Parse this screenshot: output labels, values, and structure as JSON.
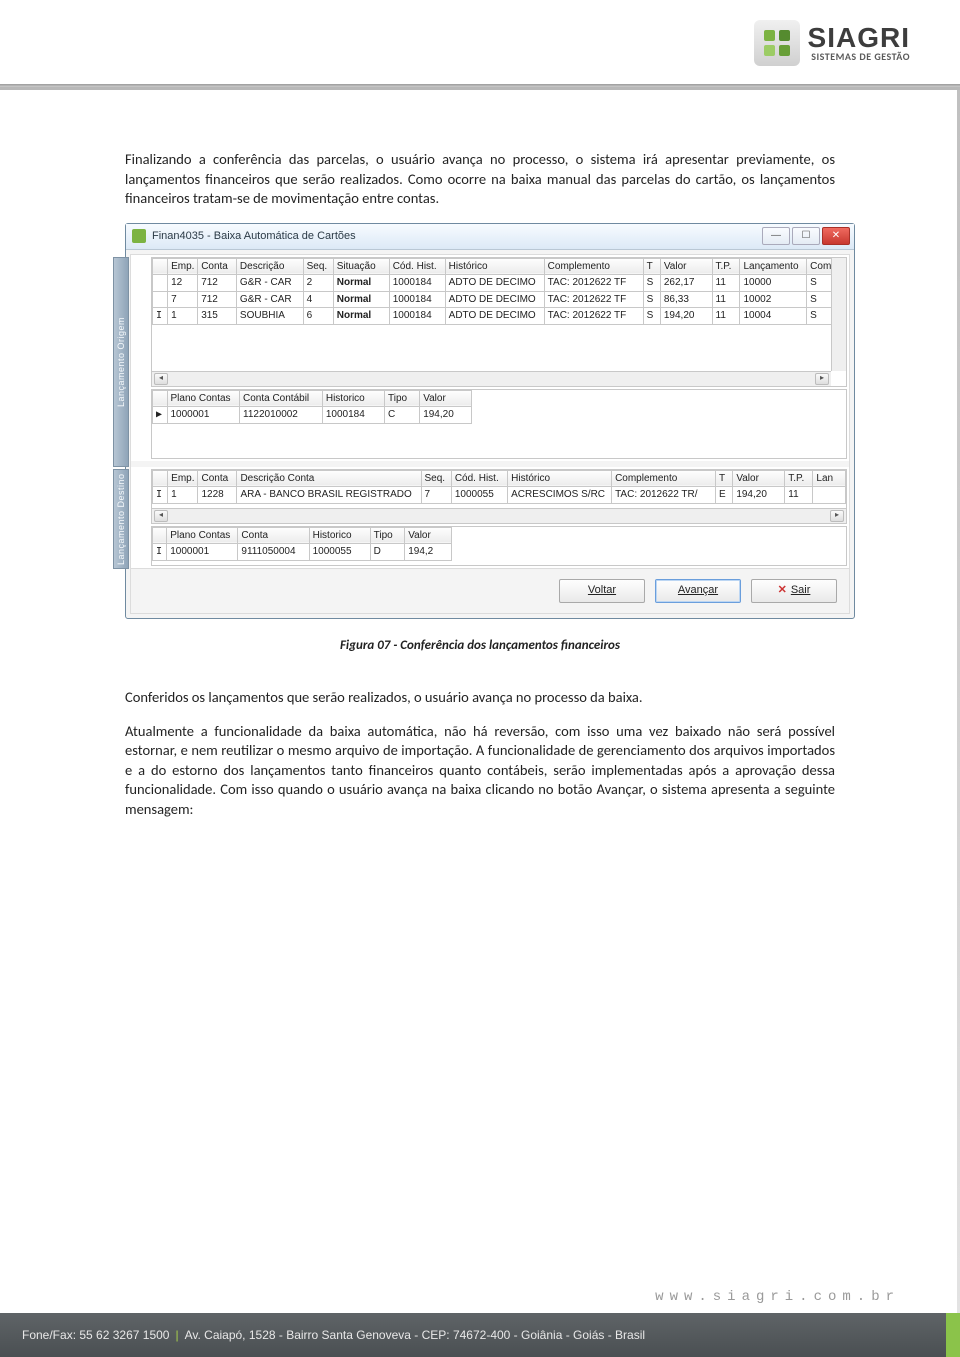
{
  "brand": {
    "name": "SIAGRI",
    "tagline": "SISTEMAS DE GESTÃO"
  },
  "para1": "Finalizando a conferência das parcelas, o usuário avança no processo, o sistema irá apresentar previamente, os lançamentos financeiros que serão realizados. Como ocorre na baixa manual das parcelas do cartão, os lançamentos financeiros tratam-se de movimentação entre contas.",
  "window": {
    "title": "Finan4035 - Baixa Automática de Cartões",
    "origem_label": "Lançamento Origem",
    "destino_label": "Lançamento Destino",
    "grid1": {
      "headers": [
        "",
        "Emp.",
        "Conta",
        "Descrição",
        "Seq.",
        "Situação",
        "Cód. Hist.",
        "Histórico",
        "Complemento",
        "T",
        "Valor",
        "T.P.",
        "Lançamento",
        "Comp"
      ],
      "rows": [
        [
          "",
          "12",
          "712",
          "G&R - CAR",
          "2",
          "Normal",
          "1000184",
          "ADTO DE DECIMO",
          "TAC: 2012622 TF",
          "S",
          "262,17",
          "11",
          "10000",
          "S"
        ],
        [
          "",
          "7",
          "712",
          "G&R - CAR",
          "4",
          "Normal",
          "1000184",
          "ADTO DE DECIMO",
          "TAC: 2012622 TF",
          "S",
          "86,33",
          "11",
          "10002",
          "S"
        ],
        [
          "I",
          "1",
          "315",
          "SOUBHIA",
          "6",
          "Normal",
          "1000184",
          "ADTO DE DECIMO",
          "TAC: 2012622 TF",
          "S",
          "194,20",
          "11",
          "10004",
          "S"
        ]
      ]
    },
    "grid2": {
      "headers": [
        "",
        "Plano Contas",
        "Conta Contábil",
        "Historico",
        "Tipo",
        "Valor"
      ],
      "rows": [
        [
          "▶",
          "1000001",
          "1122010002",
          "1000184",
          "C",
          "194,20"
        ]
      ]
    },
    "grid3": {
      "headers": [
        "",
        "Emp.",
        "Conta",
        "Descrição Conta",
        "Seq.",
        "Cód. Hist.",
        "Histórico",
        "Complemento",
        "T",
        "Valor",
        "T.P.",
        "Lan"
      ],
      "rows": [
        [
          "I",
          "1",
          "1228",
          "ARA - BANCO BRASIL REGISTRADO",
          "7",
          "1000055",
          "ACRESCIMOS S/RC",
          "TAC: 2012622 TR/",
          "E",
          "194,20",
          "11",
          ""
        ]
      ]
    },
    "grid4": {
      "headers": [
        "",
        "Plano Contas",
        "Conta",
        "Historico",
        "Tipo",
        "Valor"
      ],
      "rows": [
        [
          "I",
          "1000001",
          "9111050004",
          "1000055",
          "D",
          "194,2"
        ]
      ]
    },
    "buttons": {
      "back": "Voltar",
      "next": "Avançar",
      "exit": "Sair"
    }
  },
  "caption": "Figura 07 - Conferência dos lançamentos financeiros",
  "para2": "Conferidos os lançamentos que serão realizados, o usuário avança no processo da baixa.",
  "para3": "Atualmente a funcionalidade da baixa automática, não há reversão, com isso uma vez baixado não será possível estornar, e nem reutilizar o mesmo arquivo de importação. A funcionalidade de gerenciamento dos arquivos importados e a do estorno dos lançamentos tanto financeiros quanto contábeis, serão implementadas após a aprovação dessa funcionalidade. Com isso quando o usuário avança na baixa clicando no botão Avançar, o sistema apresenta a seguinte mensagem:",
  "website": "www.siagri.com.br",
  "footer": {
    "phone_label": "Fone/Fax:",
    "phone": "55 62 3267 1500",
    "address": "Av. Caiapó, 1528 - Bairro Santa Genoveva - CEP: 74672-400 - Goiânia - Goiás - Brasil"
  }
}
